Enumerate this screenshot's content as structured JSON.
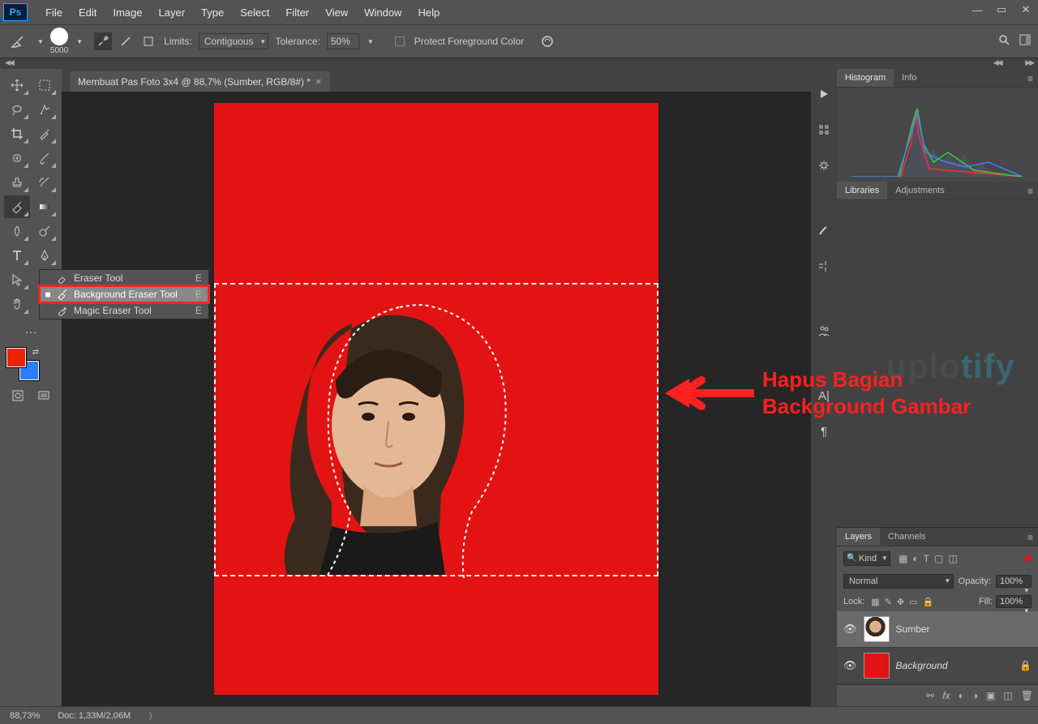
{
  "menubar": {
    "items": [
      "File",
      "Edit",
      "Image",
      "Layer",
      "Type",
      "Select",
      "Filter",
      "View",
      "Window",
      "Help"
    ]
  },
  "options_bar": {
    "brush_size": "5000",
    "limits_label": "Limits:",
    "limits_value": "Contiguous",
    "tolerance_label": "Tolerance:",
    "tolerance_value": "50%",
    "protect_label": "Protect Foreground Color"
  },
  "document": {
    "tab_title": "Membuat Pas Foto 3x4 @ 88,7% (Sumber, RGB/8#) *"
  },
  "flyout": {
    "items": [
      {
        "label": "Eraser Tool",
        "key": "E",
        "active": false
      },
      {
        "label": "Background Eraser Tool",
        "key": "E",
        "active": true
      },
      {
        "label": "Magic Eraser Tool",
        "key": "E",
        "active": false
      }
    ]
  },
  "annotation": {
    "line1": "Hapus Bagian",
    "line2": "Background Gambar"
  },
  "watermark": {
    "part1": "uplo",
    "part2": "tify"
  },
  "panels": {
    "hist_tabs": [
      "Histogram",
      "Info"
    ],
    "lib_tabs": [
      "Libraries",
      "Adjustments"
    ],
    "layers_tabs": [
      "Layers",
      "Channels"
    ]
  },
  "layers": {
    "kind": "Kind",
    "blend_mode": "Normal",
    "opacity_label": "Opacity:",
    "opacity_value": "100%",
    "lock_label": "Lock:",
    "fill_label": "Fill:",
    "fill_value": "100%",
    "items": [
      {
        "name": "Sumber",
        "locked": false,
        "active": true,
        "thumb_class": "portrait-t"
      },
      {
        "name": "Background",
        "locked": true,
        "active": false,
        "thumb_class": "red"
      }
    ]
  },
  "status": {
    "zoom": "88,73%",
    "doc": "Doc: 1,33M/2,06M"
  }
}
